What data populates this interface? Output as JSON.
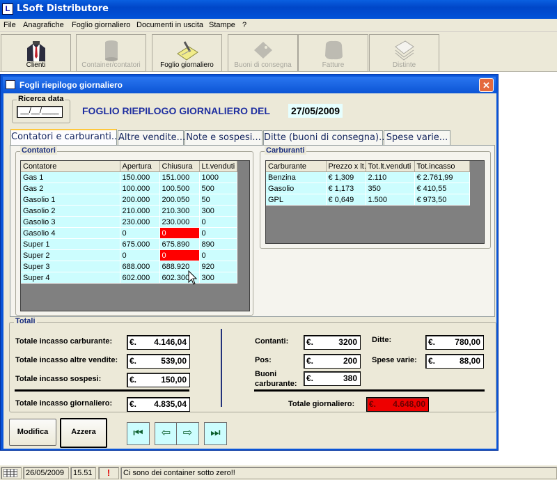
{
  "app": {
    "title": "LSoft Distributore",
    "icon": "app-icon"
  },
  "menu": [
    "File",
    "Anagrafiche",
    "Foglio giornaliero",
    "Documenti in uscita",
    "Stampe",
    "?"
  ],
  "toolbar": [
    {
      "label": "Clienti",
      "enabled": true,
      "icon": "clients-icon"
    },
    {
      "label": "Container/contatori",
      "enabled": false,
      "icon": "container-icon"
    },
    {
      "label": "Foglio giornaliero",
      "enabled": true,
      "icon": "daily-sheet-icon"
    },
    {
      "label": "Buoni di consegna",
      "enabled": false,
      "icon": "delivery-note-icon"
    },
    {
      "label": "Fatture",
      "enabled": false,
      "icon": "invoices-icon"
    },
    {
      "label": "Distinte",
      "enabled": false,
      "icon": "lists-icon"
    }
  ],
  "window": {
    "title": "Fogli riepilogo giornaliero",
    "close": "✕",
    "search": {
      "title": "Ricerca data",
      "value": "__/__/____"
    },
    "heading": "FOGLIO RIEPILOGO GIORNALIERO DEL",
    "date": "27/05/2009",
    "tabs": [
      {
        "label": "Contatori e carburanti...",
        "active": true
      },
      {
        "label": "Altre vendite...",
        "active": false
      },
      {
        "label": "Note e sospesi...",
        "active": false
      },
      {
        "label": "Ditte (buoni di consegna)...",
        "active": false
      },
      {
        "label": "Spese varie...",
        "active": false
      }
    ],
    "contatori": {
      "title": "Contatori",
      "columns": [
        "Contatore",
        "Apertura",
        "Chiusura",
        "Lt.venduti"
      ],
      "rows": [
        [
          "Gas 1",
          "150.000",
          "151.000",
          "1000"
        ],
        [
          "Gas 2",
          "100.000",
          "100.500",
          "500"
        ],
        [
          "Gasolio 1",
          "200.000",
          "200.050",
          "50"
        ],
        [
          "Gasolio 2",
          "210.000",
          "210.300",
          "300"
        ],
        [
          "Gasolio 3",
          "230.000",
          "230.000",
          "0"
        ],
        [
          "Gasolio 4",
          "0",
          "0",
          "0"
        ],
        [
          "Super 1",
          "675.000",
          "675.890",
          "890"
        ],
        [
          "Super 2",
          "0",
          "0",
          "0"
        ],
        [
          "Super 3",
          "688.000",
          "688.920",
          "920"
        ],
        [
          "Super 4",
          "602.000",
          "602.300",
          "300"
        ]
      ],
      "negative_rows": [
        5,
        7
      ],
      "highlight_color": "#ff0000"
    },
    "carburanti": {
      "title": "Carburanti",
      "columns": [
        "Carburante",
        "Prezzo x lt.",
        "Tot.lt.venduti",
        "Tot.incasso"
      ],
      "rows": [
        [
          "Benzina",
          "€ 1,309",
          "2.110",
          "€ 2.761,99"
        ],
        [
          "Gasolio",
          "€ 1,173",
          "350",
          "€ 410,55"
        ],
        [
          "GPL",
          "€ 0,649",
          "1.500",
          "€ 973,50"
        ]
      ]
    },
    "totali": {
      "title": "Totali",
      "currency": "€.",
      "incasso_carburante": {
        "label": "Totale incasso carburante:",
        "value": "4.146,04"
      },
      "incasso_altre_vendite": {
        "label": "Totale incasso altre vendite:",
        "value": "539,00"
      },
      "incasso_sospesi": {
        "label": "Totale incasso sospesi:",
        "value": "150,00"
      },
      "incasso_giornaliero": {
        "label": "Totale incasso giornaliero:",
        "value": "4.835,04"
      },
      "contanti": {
        "label": "Contanti:",
        "value": "3200"
      },
      "pos": {
        "label": "Pos:",
        "value": "200"
      },
      "buoni_carburante": {
        "label": "Buoni carburante:",
        "value": "380"
      },
      "ditte": {
        "label": "Ditte:",
        "value": "780,00"
      },
      "spese_varie": {
        "label": "Spese varie:",
        "value": "88,00"
      },
      "totale_giornaliero": {
        "label": "Totale giornaliero:",
        "value": "4.648,00",
        "color": "#ee0000"
      }
    },
    "buttons": {
      "modifica": "Modifica",
      "azzera": "Azzera"
    },
    "nav": [
      "first-record-icon",
      "previous-record-icon",
      "next-record-icon",
      "last-record-icon"
    ]
  },
  "status": {
    "date": "26/05/2009",
    "time": "15.51",
    "alert_icon": "!",
    "message": "Ci sono dei container sotto zero!!"
  },
  "colors": {
    "accent": "#0a55d8",
    "grid_cell": "#ccfdfe",
    "title_text": "#1f2fa0"
  }
}
